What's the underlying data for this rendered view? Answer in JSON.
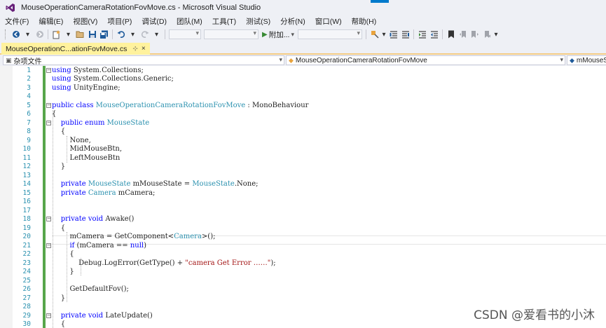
{
  "window": {
    "title": "MouseOperationCameraRotationFovMove.cs - Microsoft Visual Studio"
  },
  "menu": [
    "文件(F)",
    "编辑(E)",
    "视图(V)",
    "项目(P)",
    "调试(D)",
    "团队(M)",
    "工具(T)",
    "测试(S)",
    "分析(N)",
    "窗口(W)",
    "帮助(H)"
  ],
  "toolbar": {
    "run_label": "附加...",
    "icons": [
      "back-icon",
      "forward-icon",
      "new-project-icon",
      "open-icon",
      "save-icon",
      "save-all-icon",
      "undo-icon",
      "redo-icon",
      "bookmark-icon"
    ]
  },
  "tab": {
    "label": "MouseOperationC...ationFovMove.cs",
    "pin": "⊹",
    "close": "×"
  },
  "navbar": {
    "project": "杂项文件",
    "class": "MouseOperationCameraRotationFovMove",
    "member": "mMouseS"
  },
  "code_lines": [
    {
      "n": "1",
      "t": "using System.Collections;"
    },
    {
      "n": "2",
      "t": "using System.Collections.Generic;"
    },
    {
      "n": "3",
      "t": "using UnityEngine;"
    },
    {
      "n": "4",
      "t": ""
    },
    {
      "n": "5",
      "t": "public class MouseOperationCameraRotationFovMove : MonoBehaviour"
    },
    {
      "n": "6",
      "t": "{"
    },
    {
      "n": "7",
      "t": "    public enum MouseState"
    },
    {
      "n": "8",
      "t": "    {"
    },
    {
      "n": "9",
      "t": "        None,"
    },
    {
      "n": "10",
      "t": "        MidMouseBtn,"
    },
    {
      "n": "11",
      "t": "        LeftMouseBtn"
    },
    {
      "n": "12",
      "t": "    }"
    },
    {
      "n": "13",
      "t": ""
    },
    {
      "n": "14",
      "t": "    private MouseState mMouseState = MouseState.None;"
    },
    {
      "n": "15",
      "t": "    private Camera mCamera;"
    },
    {
      "n": "16",
      "t": ""
    },
    {
      "n": "17",
      "t": ""
    },
    {
      "n": "18",
      "t": "    private void Awake()"
    },
    {
      "n": "19",
      "t": "    {"
    },
    {
      "n": "20",
      "t": "        mCamera = GetComponent<Camera>();"
    },
    {
      "n": "21",
      "t": "        if (mCamera == null)"
    },
    {
      "n": "22",
      "t": "        {"
    },
    {
      "n": "23",
      "t": "            Debug.LogError(GetType() + \"camera Get Error ……\");"
    },
    {
      "n": "24",
      "t": "        }"
    },
    {
      "n": "25",
      "t": ""
    },
    {
      "n": "26",
      "t": "        GetDefaultFov();"
    },
    {
      "n": "27",
      "t": "    }"
    },
    {
      "n": "28",
      "t": ""
    },
    {
      "n": "29",
      "t": "    private void LateUpdate()"
    },
    {
      "n": "30",
      "t": "    {"
    }
  ],
  "watermark": "CSDN @爱看书的小沐",
  "colors": {
    "keyword": "#0000ff",
    "type": "#2b91af",
    "string": "#a31515",
    "line_number": "#2b91af",
    "tab_active": "#fff29d",
    "change_bar": "#57a64a"
  }
}
